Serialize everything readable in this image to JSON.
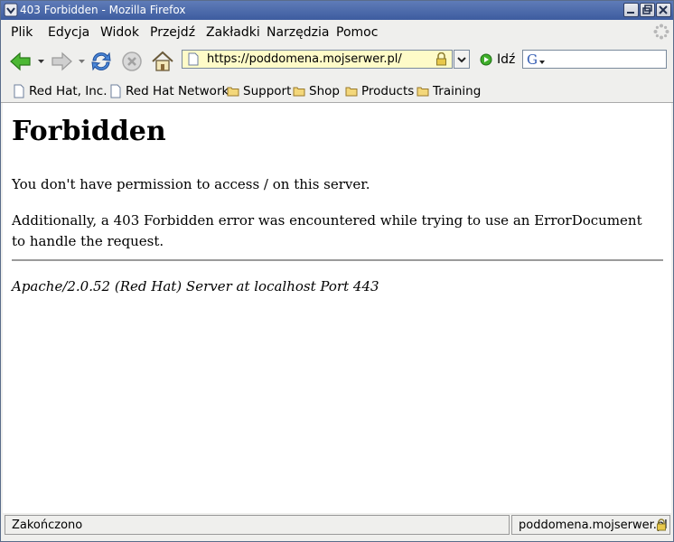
{
  "window": {
    "title": "403 Forbidden - Mozilla Firefox"
  },
  "menu": [
    "Plik",
    "Edycja",
    "Widok",
    "Przejdź",
    "Zakładki",
    "Narzędzia",
    "Pomoc"
  ],
  "toolbar": {
    "url": "https://poddomena.mojserwer.pl/",
    "go_label": "Idź",
    "search_engine": "G",
    "icons": [
      "back-icon",
      "forward-icon",
      "reload-icon",
      "stop-icon",
      "home-icon",
      "lock-icon"
    ]
  },
  "bookmarks": [
    {
      "label": "Red Hat, Inc.",
      "icon": "page-icon"
    },
    {
      "label": "Red Hat Network",
      "icon": "page-icon"
    },
    {
      "label": "Support",
      "icon": "folder-icon"
    },
    {
      "label": "Shop",
      "icon": "folder-icon"
    },
    {
      "label": "Products",
      "icon": "folder-icon"
    },
    {
      "label": "Training",
      "icon": "folder-icon"
    }
  ],
  "page": {
    "heading": "Forbidden",
    "message": "You don't have permission to access / on this server.",
    "additional": "Additionally, a 403 Forbidden error was encountered while trying to use an ErrorDocument to handle the request.",
    "address": "Apache/2.0.52 (Red Hat) Server at localhost Port 443"
  },
  "status": {
    "text": "Zakończono",
    "host": "poddomena.mojserwer.pl"
  },
  "colors": {
    "titlebar": "#4a68aa",
    "urlbar_secure_bg": "#fefbc8",
    "content_bg": "#ffffff"
  }
}
